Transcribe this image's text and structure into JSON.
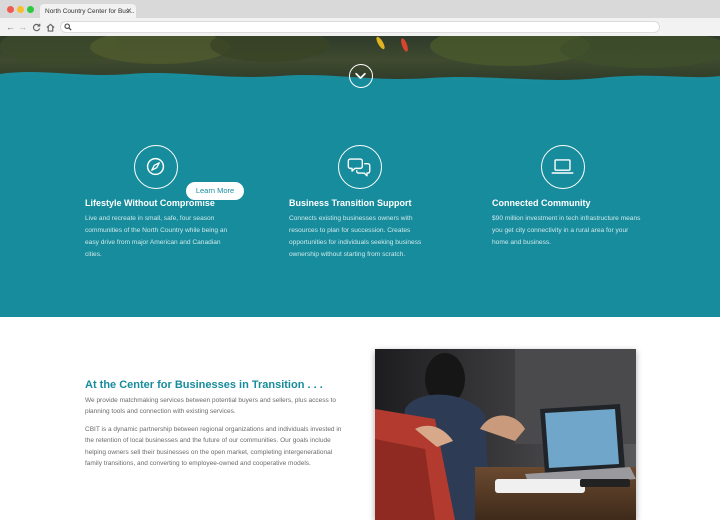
{
  "browser": {
    "tab_title": "North Country Center for Bus...",
    "tab_close": "✕",
    "url": ""
  },
  "hero": {
    "scroll_icon": "chevron-down-icon"
  },
  "features": [
    {
      "icon": "compass-icon",
      "title": "Lifestyle Without Compromise",
      "text": "Live and recreate in small, safe, four season communities of the North Country while being an easy drive from major American and Canadian cities."
    },
    {
      "icon": "chat-bubbles-icon",
      "title": "Business Transition Support",
      "text": "Connects existing businesses owners with resources to plan for succession. Creates opportunities for individuals seeking business ownership without starting from scratch."
    },
    {
      "icon": "laptop-icon",
      "title": "Connected Community",
      "text": "$90 million investment in tech infrastructure means you get city connectivity in a rural area for your home and business."
    }
  ],
  "about": {
    "heading": "At the Center for Businesses in Transition . . .",
    "paragraph1": "We provide matchmaking services between potential buyers and sellers, plus access to planning tools and connection with existing services.",
    "paragraph2": "CBIT is a dynamic partnership between regional organizations and individuals invested in the retention of local businesses and the future of our communities. Our goals include helping owners sell their businesses on the open market, completing intergenerational family transitions, and converting to employee-owned and cooperative models.",
    "button_label": "Learn More"
  },
  "colors": {
    "teal": "#178c9c",
    "white": "#ffffff",
    "body_text": "#6b6b6b"
  }
}
